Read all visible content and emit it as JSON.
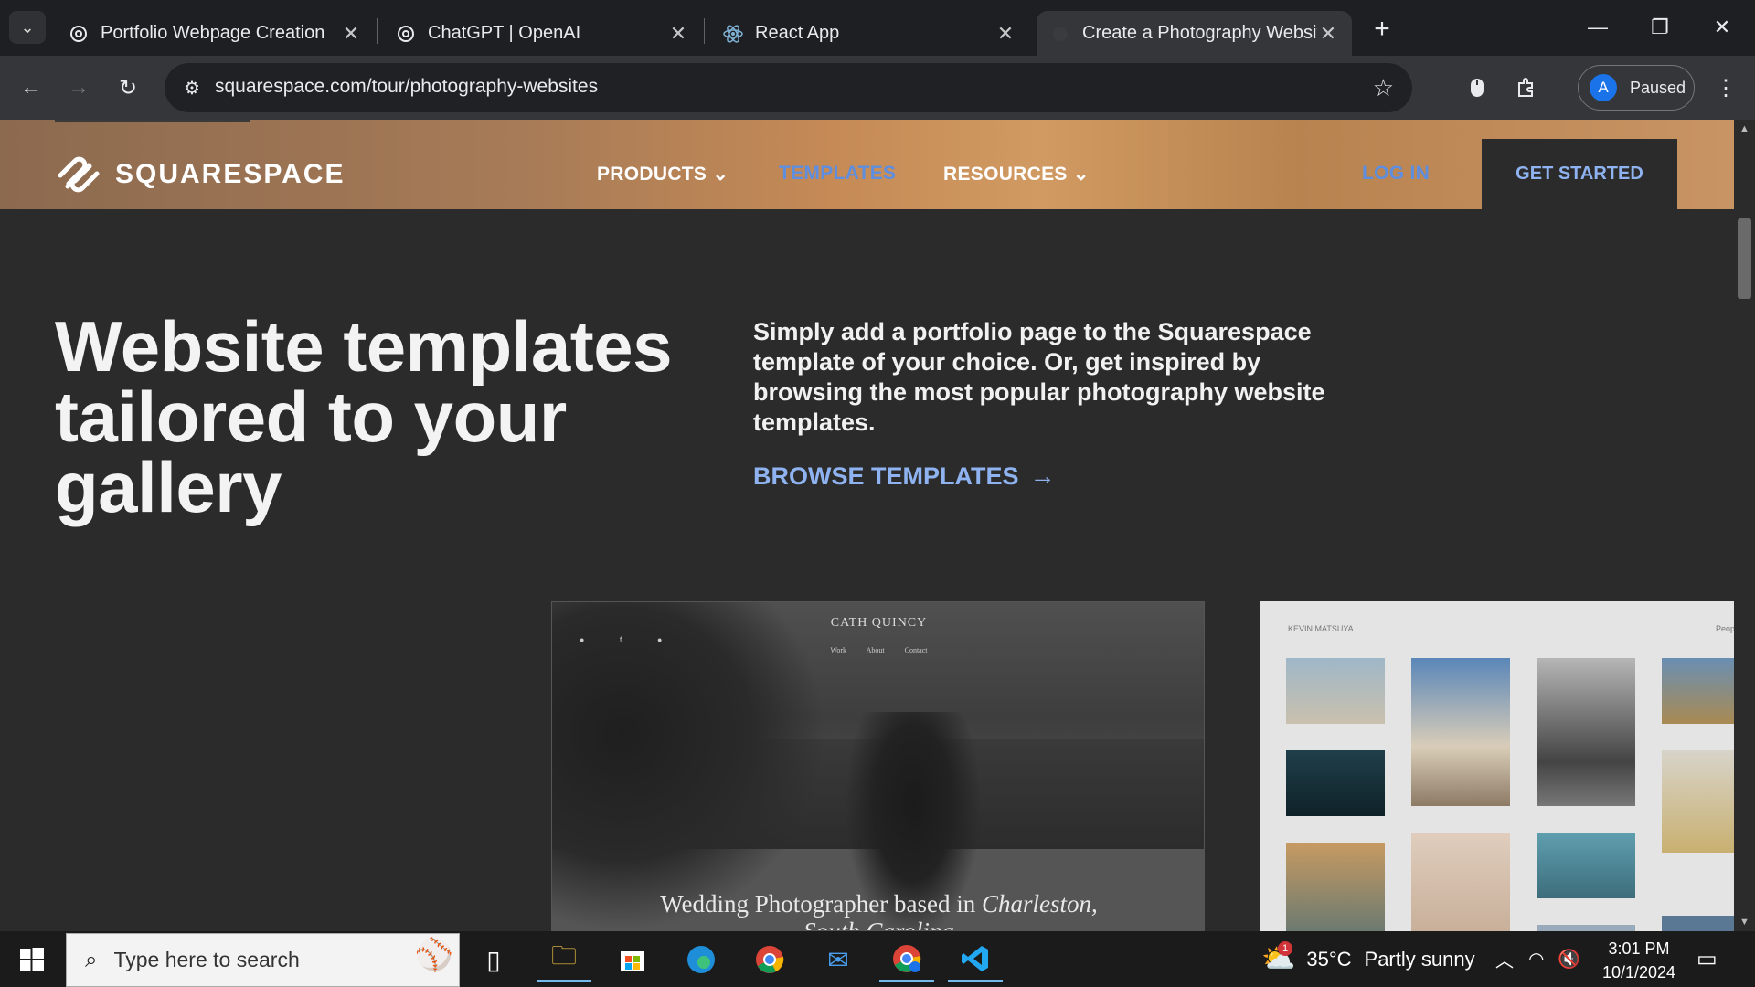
{
  "browser": {
    "tabs": [
      {
        "title": "Portfolio Webpage Creation",
        "icon": "openai-icon"
      },
      {
        "title": "ChatGPT | OpenAI",
        "icon": "openai-icon"
      },
      {
        "title": "React App",
        "icon": "react-icon"
      },
      {
        "title": "Create a Photography Website",
        "icon": "squarespace-icon",
        "active": true
      }
    ],
    "url": "squarespace.com/tour/photography-websites",
    "profile_initial": "A",
    "profile_status": "Paused"
  },
  "site": {
    "logo_text": "SQUARESPACE",
    "nav": {
      "products": "PRODUCTS",
      "templates": "TEMPLATES",
      "resources": "RESOURCES",
      "login": "LOG IN",
      "get_started": "GET STARTED"
    },
    "hero": {
      "title": "Website templates tailored to your gallery",
      "text": "Simply add a portfolio page to the Squarespace template of your choice. Or, get inspired by browsing the most popular photography website templates.",
      "cta": "BROWSE TEMPLATES"
    },
    "template1": {
      "brand": "CATH QUINCY",
      "menu": "Work About Contact",
      "caption_line1": "Wedding Photographer based in",
      "caption_city": "Charleston,",
      "caption_line2": "South Carolina"
    },
    "template2": {
      "brand": "KEVIN MATSUYA",
      "menu": "Peopl"
    }
  },
  "taskbar": {
    "search_placeholder": "Type here to search",
    "weather_temp": "35°C",
    "weather_text": "Partly sunny",
    "weather_badge": "1",
    "time": "3:01 PM",
    "date": "10/1/2024"
  },
  "colors": {
    "accent_blue": "#8fb3f0",
    "page_bg": "#2b2b2b",
    "chrome_bg": "#35363a"
  }
}
